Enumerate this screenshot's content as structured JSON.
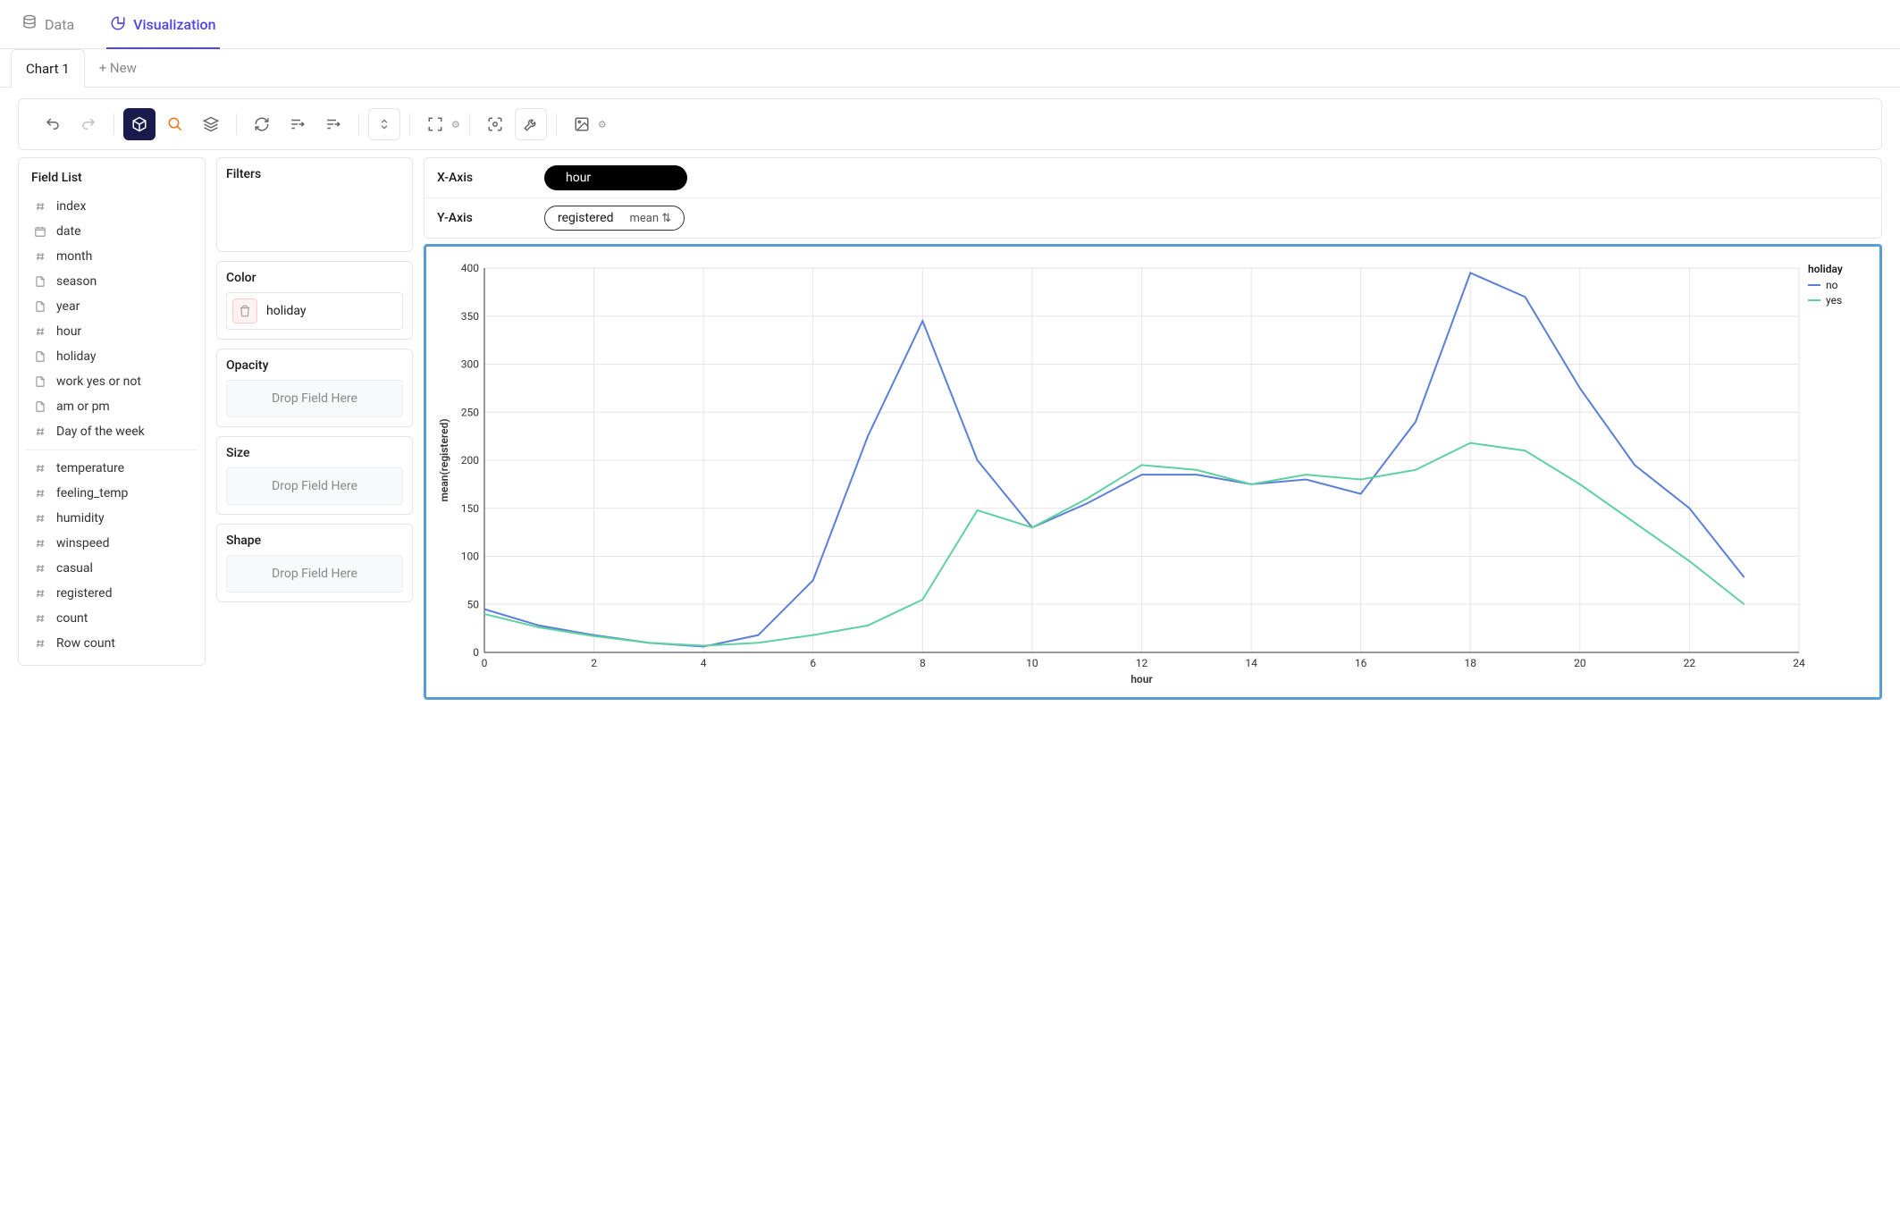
{
  "nav": {
    "data_label": "Data",
    "viz_label": "Visualization"
  },
  "chart_tabs": {
    "tabs": [
      "Chart 1"
    ],
    "new_label": "+ New",
    "active": 0
  },
  "field_list": {
    "title": "Field List",
    "group1": [
      {
        "type": "num",
        "label": "index"
      },
      {
        "type": "date",
        "label": "date"
      },
      {
        "type": "num",
        "label": "month"
      },
      {
        "type": "cat",
        "label": "season"
      },
      {
        "type": "cat",
        "label": "year"
      },
      {
        "type": "num",
        "label": "hour"
      },
      {
        "type": "cat",
        "label": "holiday"
      },
      {
        "type": "cat",
        "label": "work yes or not"
      },
      {
        "type": "cat",
        "label": "am or pm"
      },
      {
        "type": "num",
        "label": "Day of the week"
      }
    ],
    "group2": [
      {
        "type": "num",
        "label": "temperature"
      },
      {
        "type": "num",
        "label": "feeling_temp"
      },
      {
        "type": "num",
        "label": "humidity"
      },
      {
        "type": "num",
        "label": "winspeed"
      },
      {
        "type": "num",
        "label": "casual"
      },
      {
        "type": "num",
        "label": "registered"
      },
      {
        "type": "num",
        "label": "count"
      },
      {
        "type": "num",
        "label": "Row count"
      }
    ]
  },
  "encodings": {
    "filters_title": "Filters",
    "color_title": "Color",
    "color_field": "holiday",
    "opacity_title": "Opacity",
    "size_title": "Size",
    "shape_title": "Shape",
    "drop_placeholder": "Drop Field Here"
  },
  "axes": {
    "x_label": "X-Axis",
    "y_label": "Y-Axis",
    "x_field": "hour",
    "y_field": "registered",
    "y_agg": "mean"
  },
  "chart_data": {
    "type": "line",
    "xlabel": "hour",
    "ylabel": "mean(registered)",
    "x": [
      0,
      1,
      2,
      3,
      4,
      5,
      6,
      7,
      8,
      9,
      10,
      11,
      12,
      13,
      14,
      15,
      16,
      17,
      18,
      19,
      20,
      21,
      22,
      23
    ],
    "xlim": [
      0,
      24
    ],
    "ylim": [
      0,
      400
    ],
    "xticks": [
      0,
      2,
      4,
      6,
      8,
      10,
      12,
      14,
      16,
      18,
      20,
      22,
      24
    ],
    "yticks": [
      0,
      50,
      100,
      150,
      200,
      250,
      300,
      350,
      400
    ],
    "legend_title": "holiday",
    "series": [
      {
        "name": "no",
        "color": "#5b7fd6",
        "values": [
          45,
          28,
          18,
          10,
          6,
          18,
          75,
          225,
          345,
          200,
          130,
          155,
          185,
          185,
          175,
          180,
          165,
          240,
          395,
          370,
          275,
          195,
          150,
          78
        ]
      },
      {
        "name": "yes",
        "color": "#5fd0a0",
        "values": [
          40,
          26,
          17,
          10,
          7,
          10,
          18,
          28,
          55,
          148,
          130,
          160,
          195,
          190,
          175,
          185,
          180,
          190,
          218,
          210,
          175,
          135,
          95,
          50
        ]
      }
    ]
  }
}
